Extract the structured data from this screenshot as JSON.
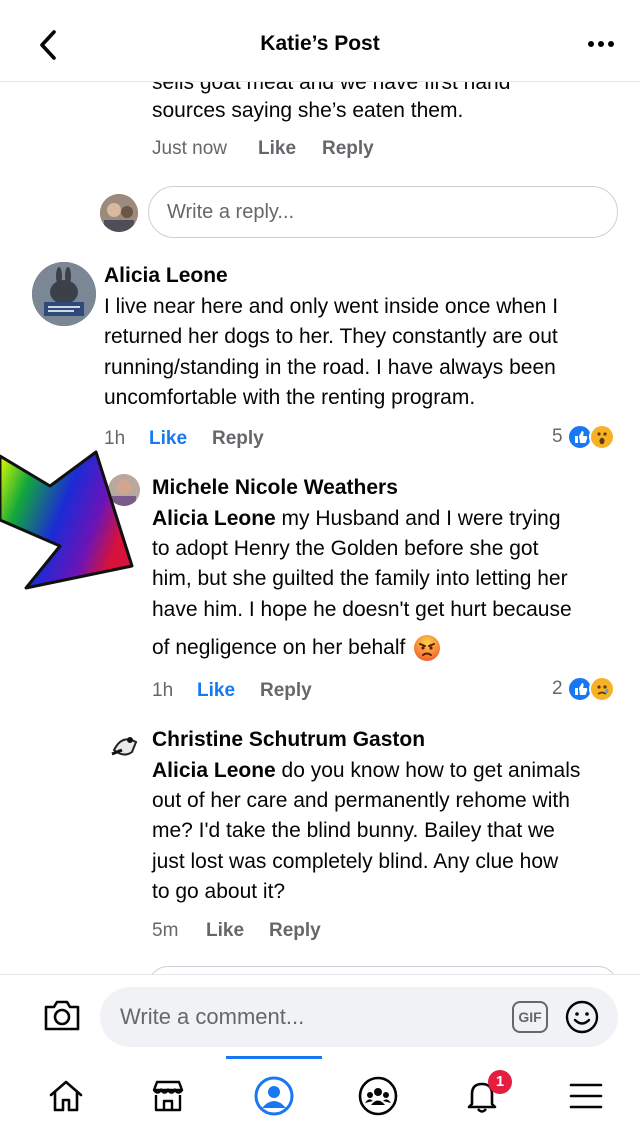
{
  "header": {
    "title": "Katie’s Post"
  },
  "prev_comment": {
    "text_cut": "sells goat meat and we have first hand",
    "text_line2": "sources saying she’s eaten them.",
    "time": "Just now",
    "like": "Like",
    "reply": "Reply"
  },
  "reply_box": {
    "placeholder": "Write a reply..."
  },
  "comments": [
    {
      "name": "Alicia Leone",
      "lines": [
        "I live near here and only went inside once when I",
        "returned her dogs to her. They constantly are out",
        "running/standing in the road. I have always been",
        "uncomfortable with the renting program."
      ],
      "time": "1h",
      "like": "Like",
      "reply": "Reply",
      "reaction_count": "5"
    },
    {
      "name": "Michele Nicole Weathers",
      "mention": "Alicia Leone",
      "line1_rest": " my Husband and I were trying",
      "lines": [
        "to adopt Henry the Golden before she got",
        "him, but she guilted the family into letting her",
        "have him. I hope he doesn't get hurt because"
      ],
      "last_line": "of negligence on her behalf",
      "time": "1h",
      "like": "Like",
      "reply": "Reply",
      "reaction_count": "2"
    },
    {
      "name": "Christine Schutrum Gaston",
      "mention": "Alicia Leone",
      "line1_rest": " do you know how to get animals",
      "lines": [
        "out of her care and permanently rehome with",
        "me? I'd take the blind bunny. Bailey that we",
        "just lost was completely blind. Any clue how",
        "to go about it?"
      ],
      "time": "5m",
      "like": "Like",
      "reply": "Reply"
    }
  ],
  "composer": {
    "placeholder": "Write a comment...",
    "gif_label": "GIF"
  },
  "tabbar": {
    "notification_count": "1"
  },
  "colors": {
    "accent": "#1877f2",
    "secondary_text": "#65676b",
    "badge": "#e41e3f"
  }
}
